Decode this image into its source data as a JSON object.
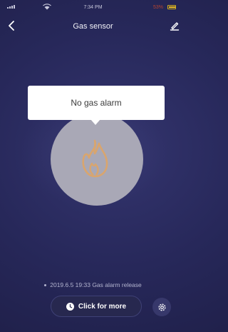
{
  "status_bar": {
    "time": "7:34 PM",
    "battery_percent": "53%",
    "colors": {
      "battery": "#f2c21f",
      "battery_text": "#b8442e"
    }
  },
  "header": {
    "title": "Gas sensor",
    "back_icon": "chevron-left-icon",
    "edit_icon": "pencil-icon"
  },
  "sensor": {
    "status_message": "No gas alarm",
    "icon": "flame-icon",
    "colors": {
      "circle": "#a9a8b6",
      "icon": "#d9a56e"
    }
  },
  "log": {
    "latest_entry": "2019.6.5 19:33 Gas alarm release"
  },
  "footer": {
    "more_button_label": "Click for more",
    "more_button_icon": "clock-icon",
    "settings_icon": "gear-icon"
  },
  "colors": {
    "background": "#27285a",
    "text_primary": "#ffffff",
    "text_secondary": "#b3b4cf"
  }
}
